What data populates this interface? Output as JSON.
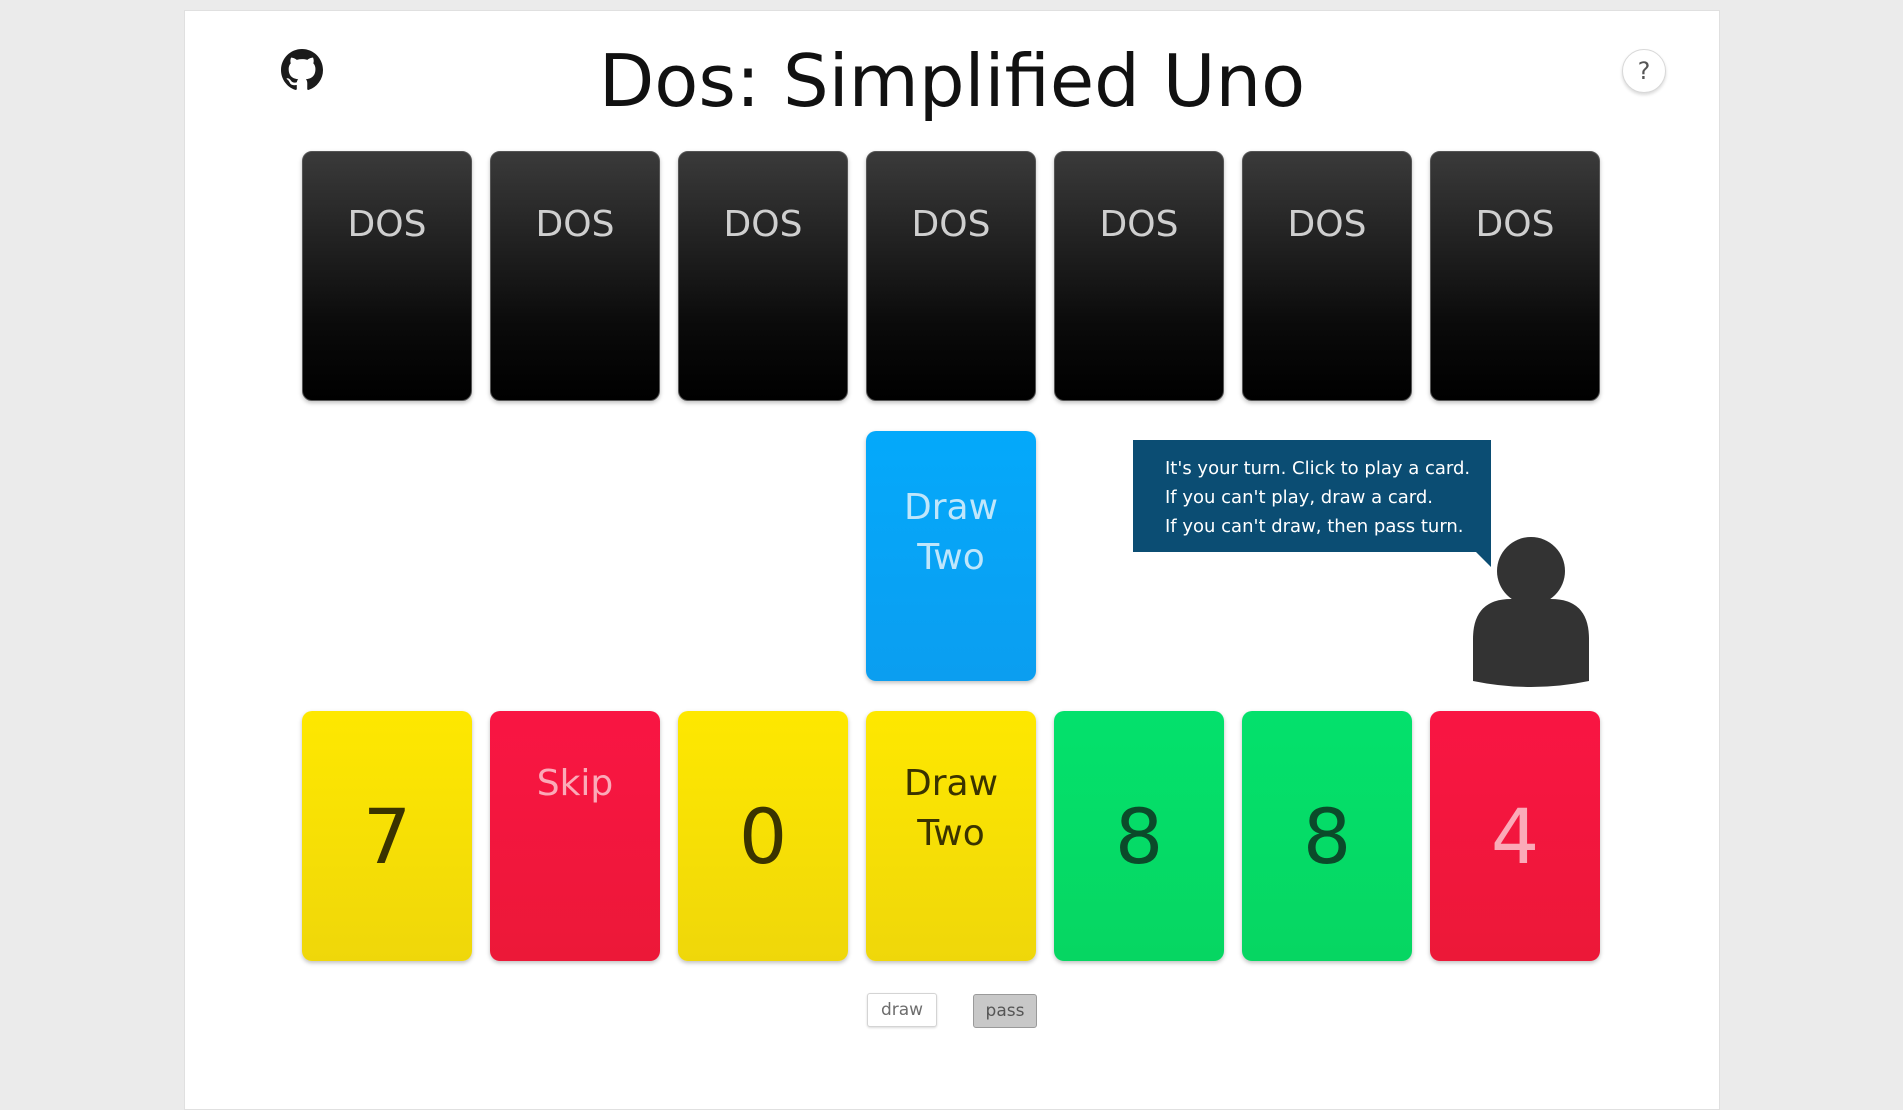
{
  "header": {
    "title": "Dos: Simplified Uno",
    "help_label": "?"
  },
  "icons": {
    "github": "github-icon",
    "avatar": "person-icon"
  },
  "opponent_hand": {
    "cards": [
      {
        "label": "DOS"
      },
      {
        "label": "DOS"
      },
      {
        "label": "DOS"
      },
      {
        "label": "DOS"
      },
      {
        "label": "DOS"
      },
      {
        "label": "DOS"
      },
      {
        "label": "DOS"
      }
    ]
  },
  "discard_pile": {
    "color": "blue",
    "line1": "Draw",
    "line2": "Two"
  },
  "message": {
    "line1": "It's your turn. Click to play a card.",
    "line2": "If you can't play, draw a card.",
    "line3": "If you can't draw, then pass turn."
  },
  "player_hand": {
    "cards": [
      {
        "color": "yellow",
        "value": "7"
      },
      {
        "color": "red",
        "value": "Skip"
      },
      {
        "color": "yellow",
        "value": "0"
      },
      {
        "color": "yellow",
        "line1": "Draw",
        "line2": "Two"
      },
      {
        "color": "green",
        "value": "8"
      },
      {
        "color": "green",
        "value": "8"
      },
      {
        "color": "red",
        "value": "4"
      }
    ]
  },
  "controls": {
    "draw_label": "draw",
    "pass_label": "pass"
  },
  "colors": {
    "yellow": "#fee800",
    "red": "#f91543",
    "green": "#04e16c",
    "blue": "#04a9fb",
    "bubble": "#0b4d73",
    "card_back": "#111111"
  }
}
